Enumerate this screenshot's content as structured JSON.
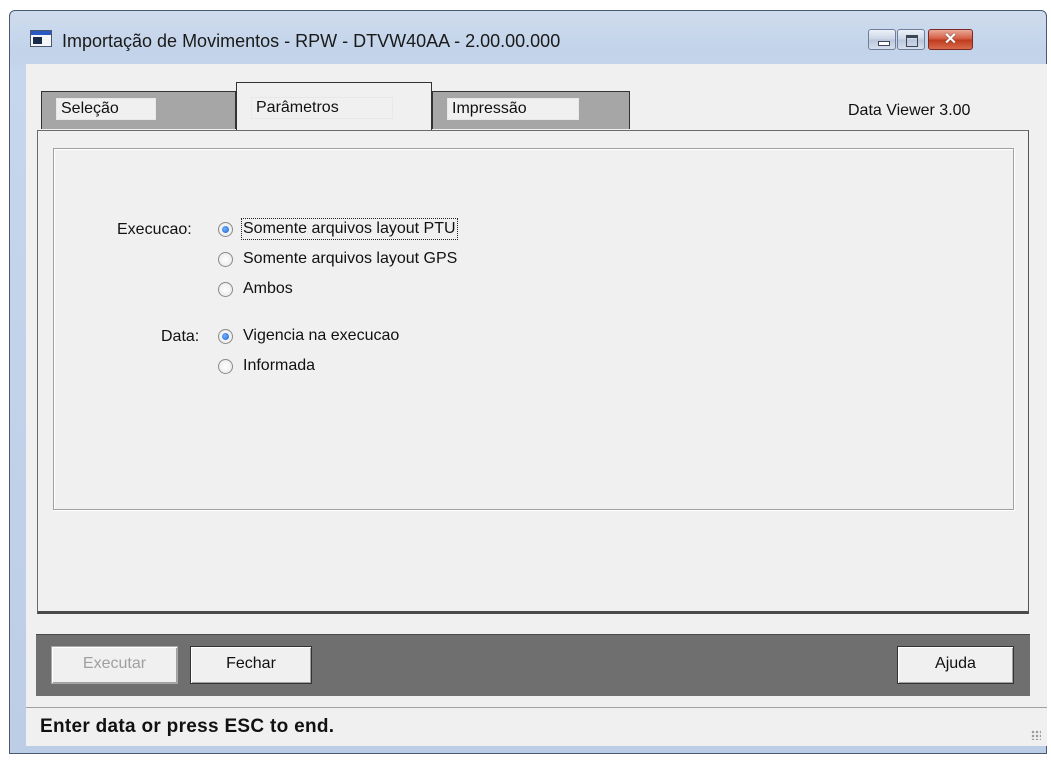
{
  "window": {
    "title": "Importação de Movimentos - RPW - DTVW40AA - 2.00.00.000",
    "icon": "app-window-icon"
  },
  "tabs": [
    {
      "label": "Seleção",
      "selected": false
    },
    {
      "label": "Parâmetros",
      "selected": true
    },
    {
      "label": "Impressão",
      "selected": false
    }
  ],
  "version_label": "Data Viewer 3.00",
  "parametros": {
    "execucao": {
      "label": "Execucao:",
      "options": [
        "Somente arquivos layout PTU",
        "Somente arquivos layout GPS",
        "Ambos"
      ],
      "selected": "Somente arquivos layout PTU"
    },
    "data": {
      "label": "Data:",
      "options": [
        "Vigencia na execucao",
        "Informada"
      ],
      "selected": "Vigencia na execucao"
    }
  },
  "buttons": {
    "executar": "Executar",
    "fechar": "Fechar",
    "ajuda": "Ajuda"
  },
  "status_text": "Enter data or press ESC to end.",
  "colors": {
    "title_bar": "#c2d3ea",
    "client_bg": "#f0f0f0",
    "button_bar": "#6f6f6f",
    "radio_selected": "#1a5fd0",
    "close_button": "#c0391c"
  }
}
